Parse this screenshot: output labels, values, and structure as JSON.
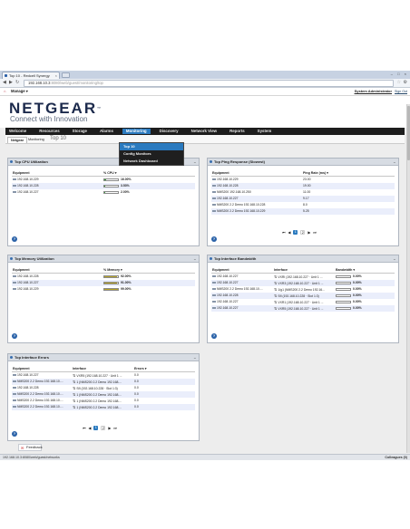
{
  "browser": {
    "tab_title": "Top 10 - Redcell Synergy",
    "tab_close": "×",
    "window_controls": "– □ ×",
    "url_host": "192.168.10.3",
    "url_path": ":8080/web/guest/monitoring/top",
    "back": "◀",
    "forward": "▶",
    "reload": "↻",
    "star": "☆",
    "wrench": "⚙",
    "status_url": "192.168.10.3:8080/web/guest/networks",
    "status_right": "Colleagues (0)"
  },
  "appbar": {
    "manage_label": "Manage ▾",
    "user_label": "System Administrator",
    "signout_label": "Sign Out"
  },
  "brand": {
    "logo": "NETGEAR",
    "tagline": "Connect with Innovation",
    "tm": "™"
  },
  "nav": {
    "items": [
      "Welcome",
      "Resources",
      "Storage",
      "Alarms",
      "Monitoring",
      "Discovery",
      "Network View",
      "Reports",
      "System"
    ],
    "active_index": 4
  },
  "dropdown": {
    "items": [
      "Top 10",
      "Config Monitors",
      "Network Dashboard"
    ],
    "highlight_index": 0
  },
  "subtabs": {
    "items": [
      "Netgear",
      "Monitoring",
      "Top 10"
    ]
  },
  "panels": {
    "cpu": {
      "title": "Top CPU Utilization",
      "headers": [
        "Equipment",
        "% CPU ▾"
      ],
      "rows": [
        {
          "equipment": "192.168.10.229",
          "value": "16.00%",
          "fill": 0.16
        },
        {
          "equipment": "192.168.10.228",
          "value": "3.53%",
          "fill": 0.035
        },
        {
          "equipment": "192.168.10.227",
          "value": "2.00%",
          "fill": 0.02
        }
      ]
    },
    "ping": {
      "title": "Top Ping Response (Slowest)",
      "headers": [
        "Equipment",
        "Ping Rate (ms) ▾"
      ],
      "rows": [
        {
          "equipment": "192.168.10.229",
          "value": "23.00"
        },
        {
          "equipment": "192.168.10.228",
          "value": "19.00"
        },
        {
          "equipment": "NMS200 192.168.10.250",
          "value": "11.00"
        },
        {
          "equipment": "192.168.10.227",
          "value": "9.17"
        },
        {
          "equipment": "NMS200 2.2 Demo 192.168.10.228",
          "value": "8.0"
        },
        {
          "equipment": "NMS200 2.2 Demo 192.168.10.229",
          "value": "5.25"
        }
      ],
      "pager": {
        "first": "⏮",
        "prev": "◀",
        "current": "1",
        "next_page": "2",
        "next": "▶",
        "last": "⏭"
      }
    },
    "memory": {
      "title": "Top Memory Utilization",
      "headers": [
        "Equipment",
        "% Memory ▾"
      ],
      "rows": [
        {
          "equipment": "192.168.10.228",
          "value": "92.00%",
          "fill": 0.92
        },
        {
          "equipment": "192.168.10.227",
          "value": "91.00%",
          "fill": 0.91
        },
        {
          "equipment": "192.168.10.229",
          "value": "99.00%",
          "fill": 0.99
        }
      ]
    },
    "bandwidth": {
      "title": "Top Interface Bandwidth",
      "headers": [
        "Equipment",
        "Interface",
        "Bandwidth ▾"
      ],
      "rows": [
        {
          "equipment": "192.168.10.227",
          "interface": "VXRI (192.168.10.227 · Unit 1 ...",
          "value": "0.00%"
        },
        {
          "equipment": "192.168.10.227",
          "interface": "VXR3 (192.168.10.227 · Unit 1 ...",
          "value": "0.00%"
        },
        {
          "equipment": "NMS200 2.2 Demo 192.168.10....",
          "interface": "1/g1 (NMS200 2.2 Demo 192.16...",
          "value": "0.00%"
        },
        {
          "equipment": "192.168.10.228",
          "interface": "SfI (192.168.10.228 · Slot 1:3)",
          "value": "0.00%"
        },
        {
          "equipment": "192.168.10.227",
          "interface": "VXR1 (192.168.10.227 · Unit 1 ...",
          "value": "0.00%"
        },
        {
          "equipment": "192.168.10.227",
          "interface": "VXR5 (192.168.10.227 · Unit 1 ...",
          "value": "0.00%"
        }
      ]
    },
    "errors": {
      "title": "Top Interface Errors",
      "headers": [
        "Equipment",
        "Interface",
        "Errors ▾"
      ],
      "rows": [
        {
          "equipment": "192.168.10.227",
          "interface": "VXR5 (192.168.10.227 · Unit 1 ...",
          "value": "0.0"
        },
        {
          "equipment": "NMS200 2.2 Demo 192.168.10....",
          "interface": "1 (NMS200 2.2 Demo 192.168....",
          "value": "0.0"
        },
        {
          "equipment": "192.168.10.228",
          "interface": "SfI (192.168.10.228 · Slot 1:3)",
          "value": "0.0"
        },
        {
          "equipment": "NMS200 2.2 Demo 192.168.10....",
          "interface": "1 (NMS200 2.2 Demo 192.168....",
          "value": "0.0"
        },
        {
          "equipment": "NMS200 2.2 Demo 192.168.10....",
          "interface": "1 (NMS200 2.2 Demo 192.168....",
          "value": "0.0"
        },
        {
          "equipment": "NMS200 2.2 Demo 192.168.10....",
          "interface": "1 (NMS200 2.2 Demo 192.168....",
          "value": "0.0"
        }
      ],
      "pager": {
        "first": "⏮",
        "prev": "◀",
        "current": "1",
        "next_page": "2",
        "next": "▶",
        "last": "⏭"
      }
    }
  },
  "feedback_label": "Feedback",
  "help_label": "?",
  "minimize_label": "–",
  "colors": {
    "accent": "#2a7abf",
    "navbar": "#1d1d1d",
    "cpu_fill": "#39a33a",
    "mem_fill": "#b6a329"
  }
}
